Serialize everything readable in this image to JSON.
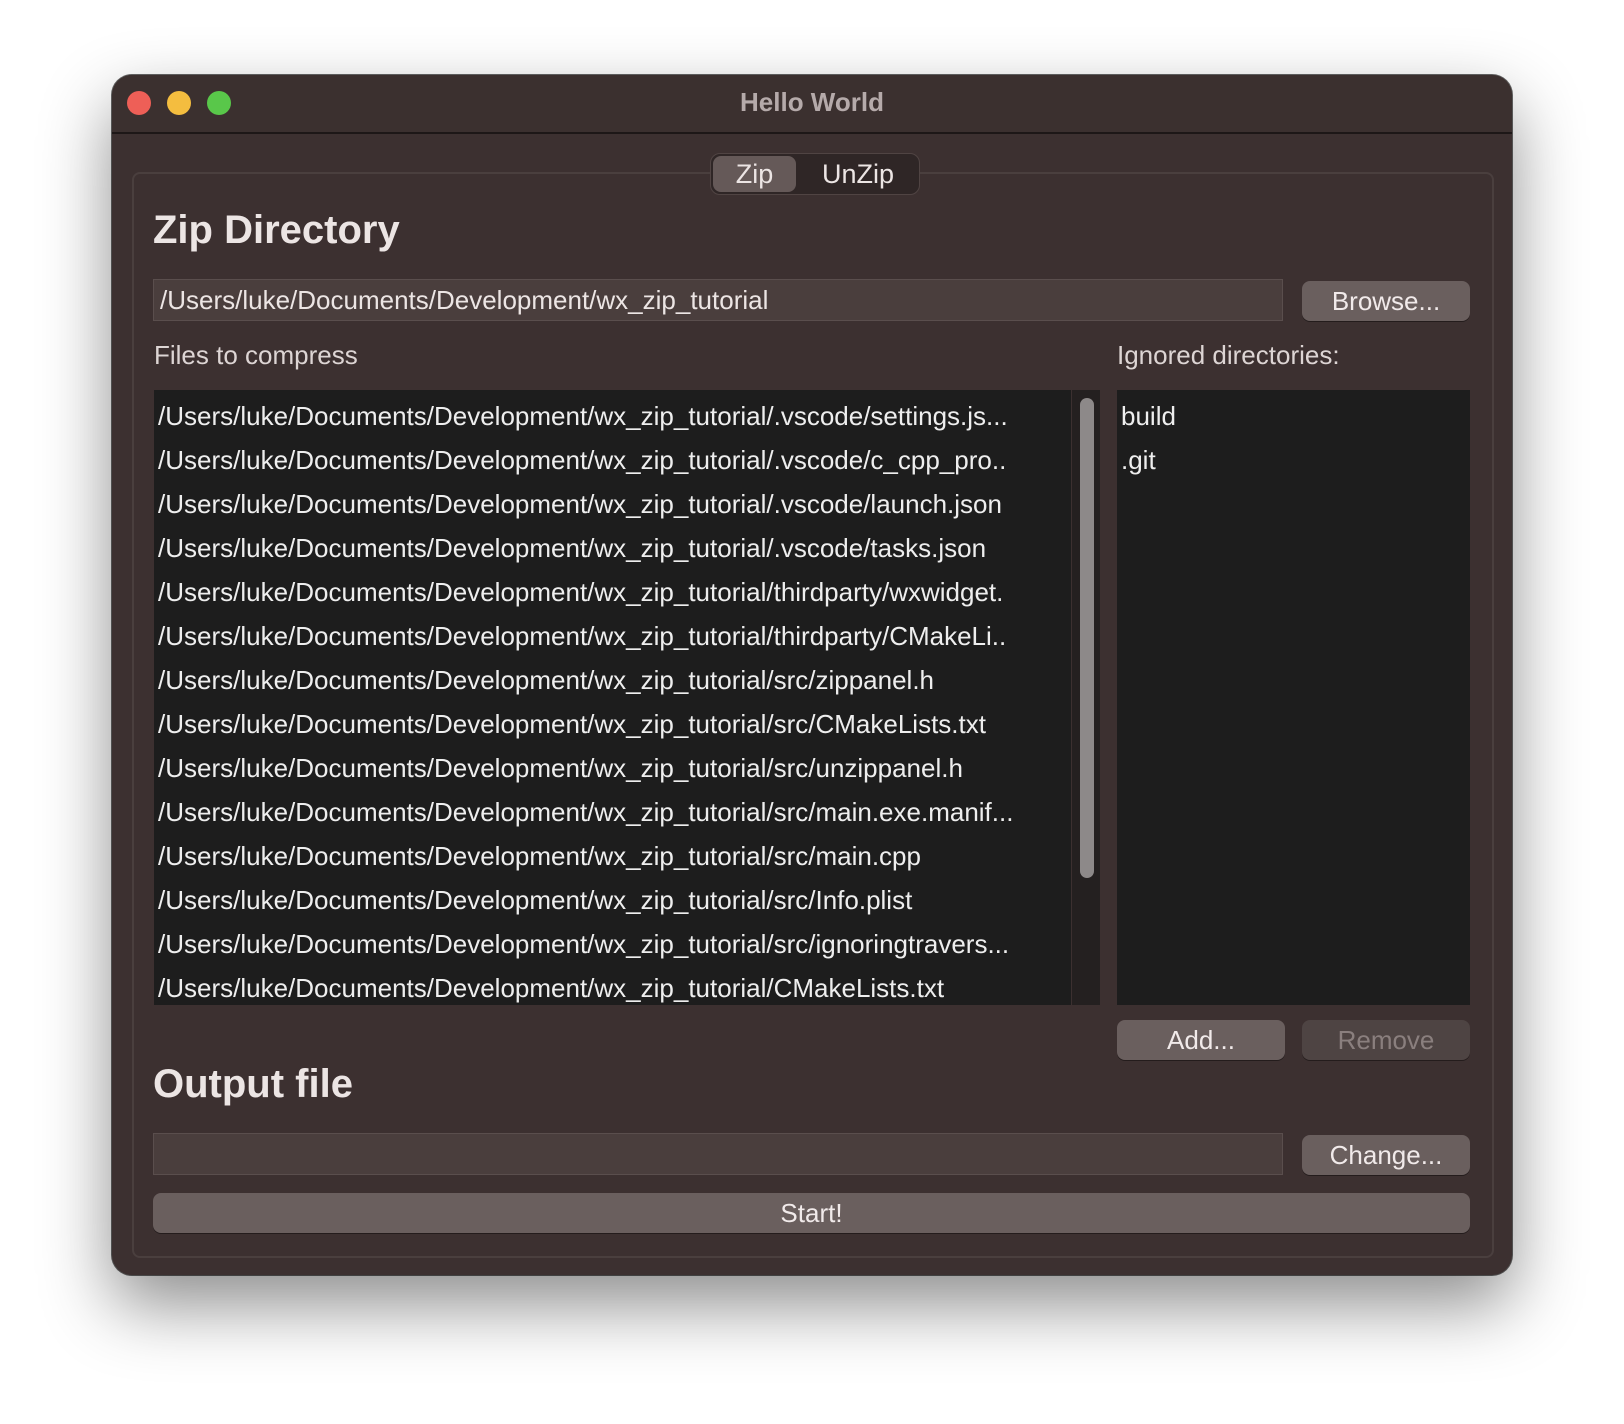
{
  "window": {
    "title": "Hello World"
  },
  "tabs": [
    {
      "label": "Zip",
      "selected": true
    },
    {
      "label": "UnZip",
      "selected": false
    }
  ],
  "zip": {
    "heading": "Zip Directory",
    "directory_value": "/Users/luke/Documents/Development/wx_zip_tutorial",
    "browse_label": "Browse...",
    "files_label": "Files to compress",
    "files": [
      "/Users/luke/Documents/Development/wx_zip_tutorial/.vscode/settings.js...",
      "/Users/luke/Documents/Development/wx_zip_tutorial/.vscode/c_cpp_pro..",
      "/Users/luke/Documents/Development/wx_zip_tutorial/.vscode/launch.json",
      "/Users/luke/Documents/Development/wx_zip_tutorial/.vscode/tasks.json",
      "/Users/luke/Documents/Development/wx_zip_tutorial/thirdparty/wxwidget.",
      "/Users/luke/Documents/Development/wx_zip_tutorial/thirdparty/CMakeLi..",
      "/Users/luke/Documents/Development/wx_zip_tutorial/src/zippanel.h",
      "/Users/luke/Documents/Development/wx_zip_tutorial/src/CMakeLists.txt",
      "/Users/luke/Documents/Development/wx_zip_tutorial/src/unzippanel.h",
      "/Users/luke/Documents/Development/wx_zip_tutorial/src/main.exe.manif...",
      "/Users/luke/Documents/Development/wx_zip_tutorial/src/main.cpp",
      "/Users/luke/Documents/Development/wx_zip_tutorial/src/Info.plist",
      "/Users/luke/Documents/Development/wx_zip_tutorial/src/ignoringtravers...",
      "/Users/luke/Documents/Development/wx_zip_tutorial/CMakeLists.txt"
    ],
    "ignored_label": "Ignored directories:",
    "ignored": [
      "build",
      ".git"
    ],
    "add_label": "Add...",
    "remove_label": "Remove"
  },
  "output": {
    "heading": "Output file",
    "value": "",
    "change_label": "Change...",
    "start_label": "Start!"
  },
  "colors": {
    "window_bg": "#3c3030",
    "list_bg": "#1d1d1d",
    "button_bg": "#6a5f5e",
    "close": "#ee5f57",
    "minimize": "#f4bd3f",
    "zoom": "#59c74a"
  }
}
